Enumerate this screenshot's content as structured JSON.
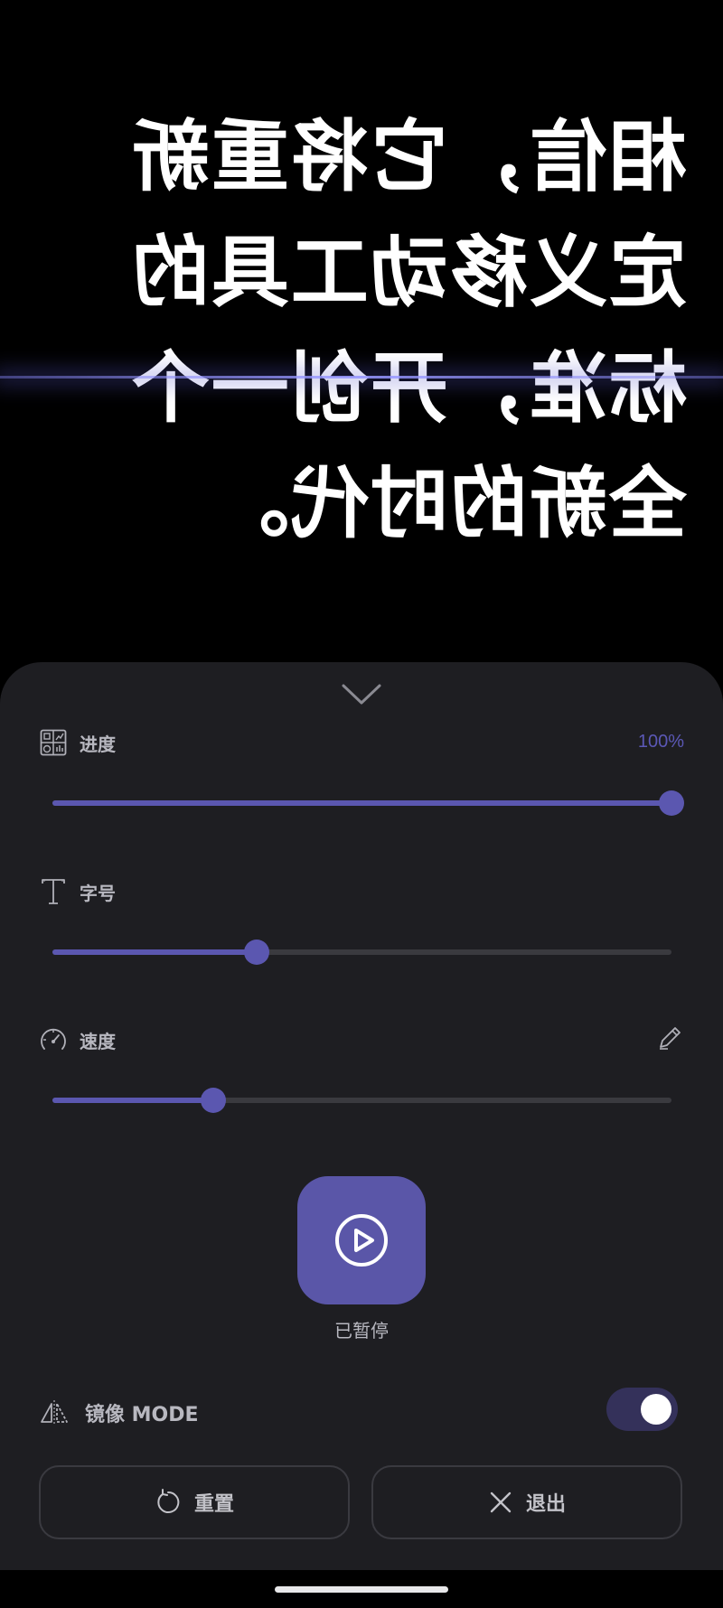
{
  "prompter": {
    "text": "相信，它将重新定义移动工具的标准，开创一个全新的时代。",
    "mirrored": true
  },
  "controls": {
    "progress": {
      "label": "进度",
      "value_text": "100%",
      "value": 1.0,
      "icon": "dashboard-grid-icon"
    },
    "font_size": {
      "label": "字号",
      "value": 0.33,
      "icon": "text-type-icon"
    },
    "speed": {
      "label": "速度",
      "value": 0.26,
      "icon": "speedometer-icon",
      "edit_icon": "pencil-icon"
    }
  },
  "playback": {
    "status": "已暂停",
    "icon": "play-circle-icon"
  },
  "mirror": {
    "label": "镜像 MODE",
    "enabled": true,
    "icon": "mirror-flip-icon"
  },
  "buttons": {
    "reset_label": "重置",
    "exit_label": "退出"
  },
  "colors": {
    "accent": "#5b57b0",
    "panel_bg": "#1e1e22",
    "text_secondary": "#b8b8c0"
  }
}
